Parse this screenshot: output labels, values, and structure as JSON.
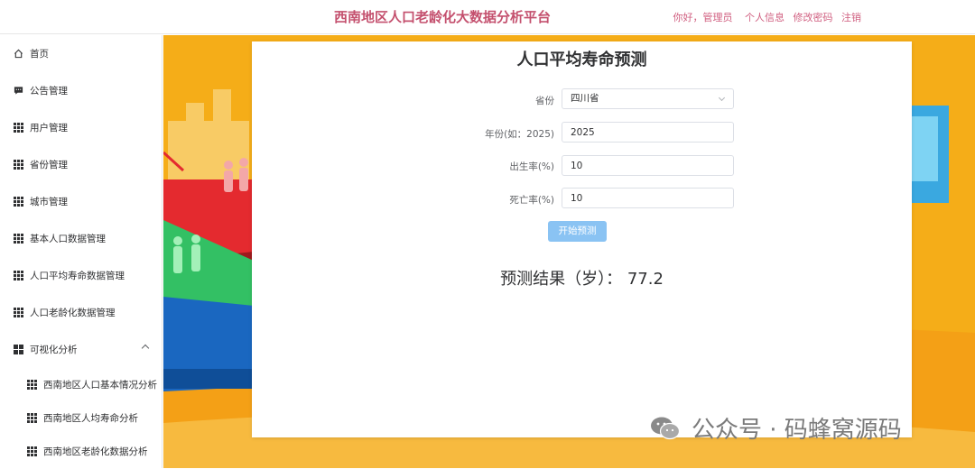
{
  "header": {
    "title": "西南地区人口老龄化大数据分析平台",
    "greeting": "你好，管理员",
    "links": [
      "个人信息",
      "修改密码",
      "注销"
    ]
  },
  "sidebar": {
    "items": [
      {
        "label": "首页",
        "icon": "home-icon"
      },
      {
        "label": "公告管理",
        "icon": "message-icon"
      },
      {
        "label": "用户管理",
        "icon": "grid-icon"
      },
      {
        "label": "省份管理",
        "icon": "grid-icon"
      },
      {
        "label": "城市管理",
        "icon": "grid-icon"
      },
      {
        "label": "基本人口数据管理",
        "icon": "grid-icon"
      },
      {
        "label": "人口平均寿命数据管理",
        "icon": "grid-icon"
      },
      {
        "label": "人口老龄化数据管理",
        "icon": "grid-icon"
      },
      {
        "label": "可视化分析",
        "icon": "quad-icon",
        "expanded": true
      }
    ],
    "subitems": [
      {
        "label": "西南地区人口基本情况分析",
        "icon": "grid-icon"
      },
      {
        "label": "西南地区人均寿命分析",
        "icon": "grid-icon"
      },
      {
        "label": "西南地区老龄化数据分析",
        "icon": "grid-icon"
      }
    ]
  },
  "form": {
    "title": "人口平均寿命预测",
    "province_label": "省份",
    "province_value": "四川省",
    "year_label": "年份(如：2025)",
    "year_value": "2025",
    "birth_label": "出生率(%)",
    "birth_value": "10",
    "death_label": "死亡率(%)",
    "death_value": "10",
    "button_label": "开始预测",
    "result_text": "预测结果（岁）： 77.2"
  },
  "watermark": {
    "text": "公众号 · 码蜂窝源码"
  },
  "colors": {
    "title": "#c4506e",
    "accent_button": "#8ac3f3",
    "background_orange": "#f5ad18"
  }
}
